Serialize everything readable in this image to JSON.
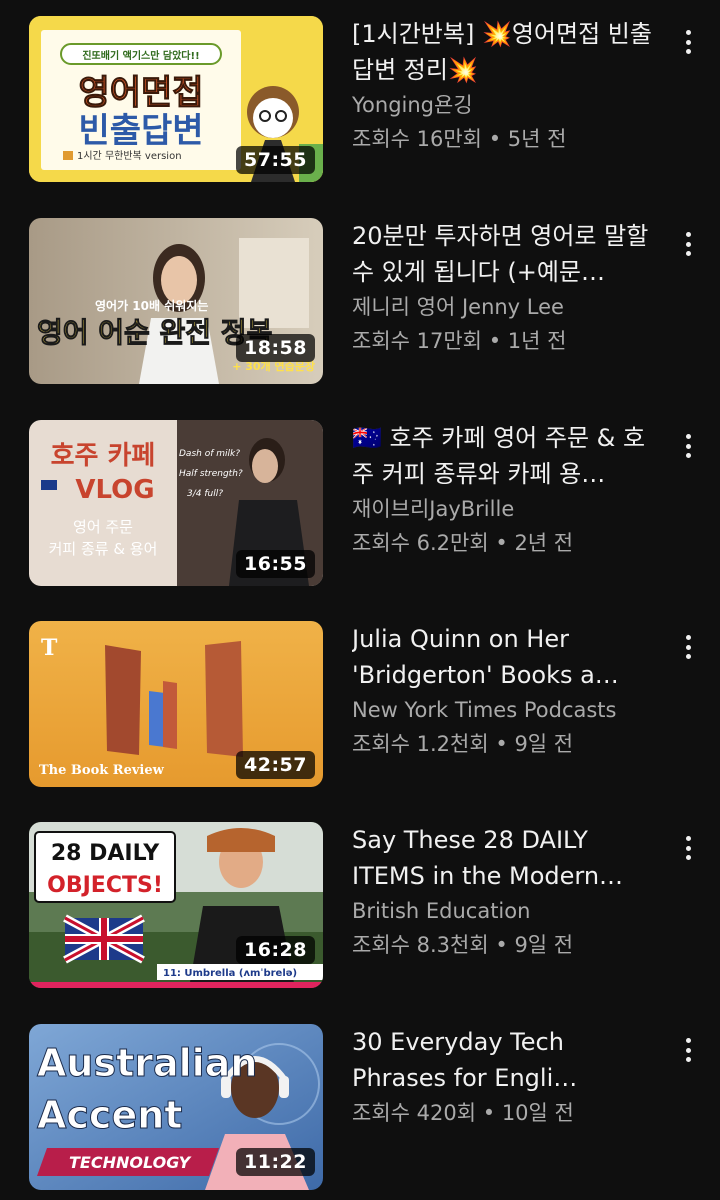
{
  "videos": [
    {
      "title": "[1시간반복] 💥영어면접 빈출답변 정리💥",
      "channel": "Yonging욘깅",
      "views": "조회수 16만회",
      "age": "5년 전",
      "duration": "57:55",
      "thumb_text": {
        "top": "진또배기 액기스만 담았다!!",
        "line1": "영어면접",
        "line2": "빈출답변",
        "footer": "1시간 무한반복 version"
      }
    },
    {
      "title": "20분만 투자하면 영어로 말할 수 있게 됩니다 (+예문…",
      "channel": "제니리 영어 Jenny Lee",
      "views": "조회수 17만회",
      "age": "1년 전",
      "duration": "18:58",
      "thumb_text": {
        "top": "영어가 10배 쉬워지는",
        "main": "영어 어순 완전 정복",
        "sub": "+ 30개 연습문장"
      }
    },
    {
      "title": "🇦🇺 호주 카페 영어 주문 & 호주 커피 종류와 카페 용…",
      "channel": "재이브리JayBrille",
      "views": "조회수 6.2만회",
      "age": "2년 전",
      "duration": "16:55",
      "thumb_text": {
        "line1": "호주 카페",
        "line2": "VLOG",
        "line3": "영어 주문",
        "line4": "커피 종류 & 용어",
        "q1": "Dash of milk?",
        "q2": "Half strength?",
        "q3": "3/4 full?"
      }
    },
    {
      "title": "Julia Quinn on Her 'Bridgerton' Books a…",
      "channel": "New York Times Podcasts",
      "views": "조회수 1.2천회",
      "age": "9일 전",
      "duration": "42:57",
      "thumb_text": {
        "logo": "T",
        "caption": "The Book Review"
      }
    },
    {
      "title": "Say These 28 DAILY ITEMS in the Modern…",
      "channel": "British Education",
      "views": "조회수 8.3천회",
      "age": "9일 전",
      "duration": "16:28",
      "thumb_text": {
        "line1": "28 DAILY",
        "line2": "OBJECTS!",
        "caption": "11: Umbrella (ʌmˈbrelə)"
      }
    },
    {
      "title": "30 Everyday Tech Phrases for Engli…",
      "channel": "",
      "views": "조회수 420회",
      "age": "10일 전",
      "duration": "11:22",
      "thumb_text": {
        "line1": "Australian",
        "line2": "Accent",
        "banner": "TECHNOLOGY"
      }
    }
  ],
  "separator": "•",
  "colors": {
    "background": "#0f0f0f",
    "primary_text": "#f1f1f1",
    "secondary_text": "#aaaaaa"
  }
}
